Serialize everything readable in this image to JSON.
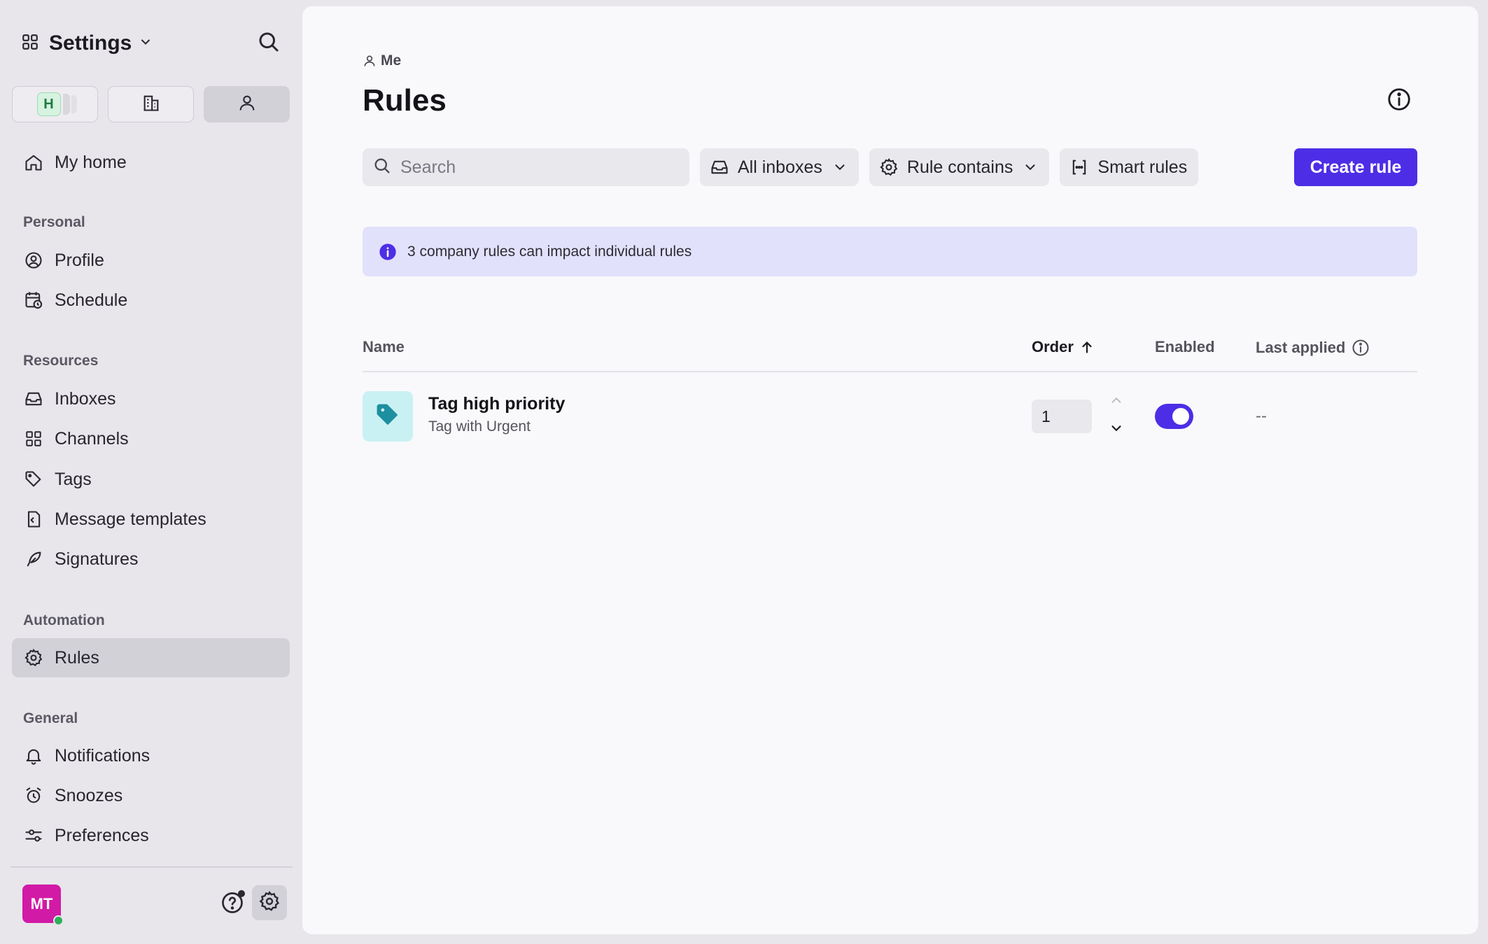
{
  "sidebar": {
    "title": "Settings",
    "scope_buttons": {
      "workspace_badge": "H"
    },
    "home_label": "My home",
    "sections": {
      "personal": "Personal",
      "resources": "Resources",
      "automation": "Automation",
      "general": "General"
    },
    "items": {
      "profile": "Profile",
      "schedule": "Schedule",
      "inboxes": "Inboxes",
      "channels": "Channels",
      "tags": "Tags",
      "message_templates": "Message templates",
      "signatures": "Signatures",
      "rules": "Rules",
      "notifications": "Notifications",
      "snoozes": "Snoozes",
      "preferences": "Preferences"
    },
    "user_initials": "MT"
  },
  "main": {
    "breadcrumb": "Me",
    "title": "Rules",
    "search_placeholder": "Search",
    "filters": {
      "inboxes": "All inboxes",
      "rule_contains": "Rule contains",
      "smart_rules": "Smart rules"
    },
    "create_button": "Create rule",
    "banner_text": "3 company rules can impact individual rules",
    "table": {
      "headers": {
        "name": "Name",
        "order": "Order",
        "enabled": "Enabled",
        "last_applied": "Last applied"
      },
      "rows": [
        {
          "name": "Tag high priority",
          "description": "Tag with Urgent",
          "order": "1",
          "enabled": true,
          "last_applied": "--"
        }
      ]
    }
  },
  "colors": {
    "accent": "#4d2ee6",
    "banner_bg": "#e2e1fb",
    "avatar": "#d11aa6",
    "tag_icon_bg": "#c9f1f4",
    "tag_icon": "#1d8fa0"
  }
}
